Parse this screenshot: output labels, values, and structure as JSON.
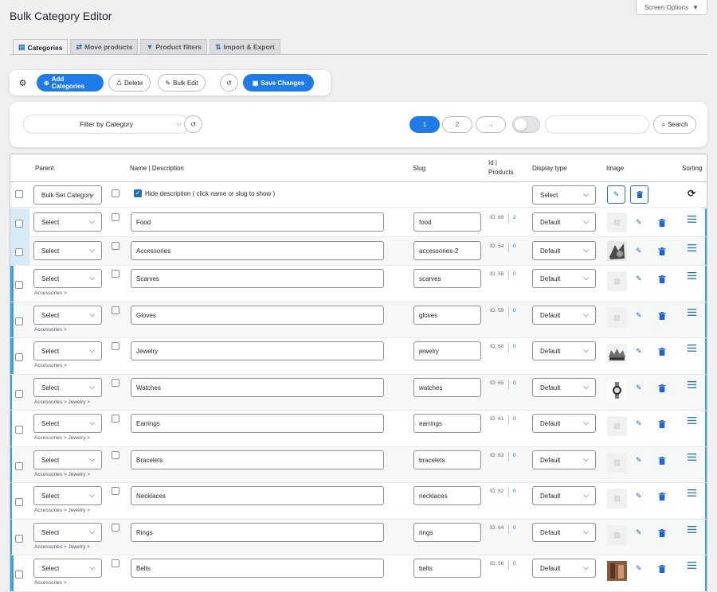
{
  "page": {
    "title": "Bulk Category Editor",
    "screen_options": "Screen Options"
  },
  "tabs": [
    {
      "label": "Categories",
      "icon": "table-icon",
      "active": true
    },
    {
      "label": "Move products",
      "icon": "swap-arrows-icon"
    },
    {
      "label": "Product filters",
      "icon": "filter-icon"
    },
    {
      "label": "Import & Export",
      "icon": "import-export-icon"
    }
  ],
  "toolbar": {
    "add_label": "Add Categories",
    "delete_label": "Delete",
    "bulk_edit_label": "Bulk Edit",
    "save_label": "Save Changes"
  },
  "filter": {
    "category_placeholder": "Filter by Category",
    "pages": [
      "1",
      "2"
    ],
    "current_page": "1",
    "next": "→",
    "search_label": "Search",
    "search_value": ""
  },
  "table": {
    "headers": {
      "parent": "Parent",
      "name": "Name | Description",
      "slug": "Slug",
      "id_line1": "Id |",
      "id_line2": "Products",
      "display": "Display type",
      "image": "Image",
      "sorting": "Sorting"
    },
    "bulk": {
      "parent_select": "Bulk Set Category",
      "hide_desc_label": "Hide description ( click name or slug to show )",
      "display_select": "Select"
    },
    "rows": [
      {
        "parent": "Select",
        "path": "",
        "name": "Food",
        "slug": "food",
        "id": "ID: 69",
        "products": "2",
        "display": "Default",
        "image": "none"
      },
      {
        "parent": "Select",
        "path": "",
        "name": "Accessories",
        "slug": "accessories-2",
        "id": "ID: 54",
        "products": "0",
        "display": "Default",
        "image": "accessories"
      },
      {
        "parent": "Select",
        "path": "Accessories >",
        "name": "Scarves",
        "slug": "scarves",
        "id": "ID: 58",
        "products": "0",
        "display": "Default",
        "image": "none"
      },
      {
        "parent": "Select",
        "path": "Accessories >",
        "name": "Gloves",
        "slug": "gloves",
        "id": "ID: 59",
        "products": "0",
        "display": "Default",
        "image": "none"
      },
      {
        "parent": "Select",
        "path": "Accessories >",
        "name": "Jewelry",
        "slug": "jewelry",
        "id": "ID: 60",
        "products": "0",
        "display": "Default",
        "image": "jewelry"
      },
      {
        "parent": "Select",
        "path": "Accessories > Jewelry >",
        "name": "Watches",
        "slug": "watches",
        "id": "ID: 65",
        "products": "0",
        "display": "Default",
        "image": "watch"
      },
      {
        "parent": "Select",
        "path": "Accessories > Jewelry >",
        "name": "Earrings",
        "slug": "earrings",
        "id": "ID: 61",
        "products": "0",
        "display": "Default",
        "image": "none"
      },
      {
        "parent": "Select",
        "path": "Accessories > Jewelry >",
        "name": "Bracelets",
        "slug": "bracelets",
        "id": "ID: 63",
        "products": "0",
        "display": "Default",
        "image": "none"
      },
      {
        "parent": "Select",
        "path": "Accessories > Jewelry >",
        "name": "Necklaces",
        "slug": "necklaces",
        "id": "ID: 62",
        "products": "0",
        "display": "Default",
        "image": "none"
      },
      {
        "parent": "Select",
        "path": "Accessories > Jewelry >",
        "name": "Rings",
        "slug": "rings",
        "id": "ID: 64",
        "products": "0",
        "display": "Default",
        "image": "none"
      },
      {
        "parent": "Select",
        "path": "Accessories >",
        "name": "Belts",
        "slug": "belts",
        "id": "ID: 56",
        "products": "0",
        "display": "Default",
        "image": "belts"
      }
    ]
  },
  "colors": {
    "primary": "#1e7be8",
    "accent": "#2271b1",
    "delete": "#1e66d2",
    "row_bar": "#37a5e5"
  }
}
